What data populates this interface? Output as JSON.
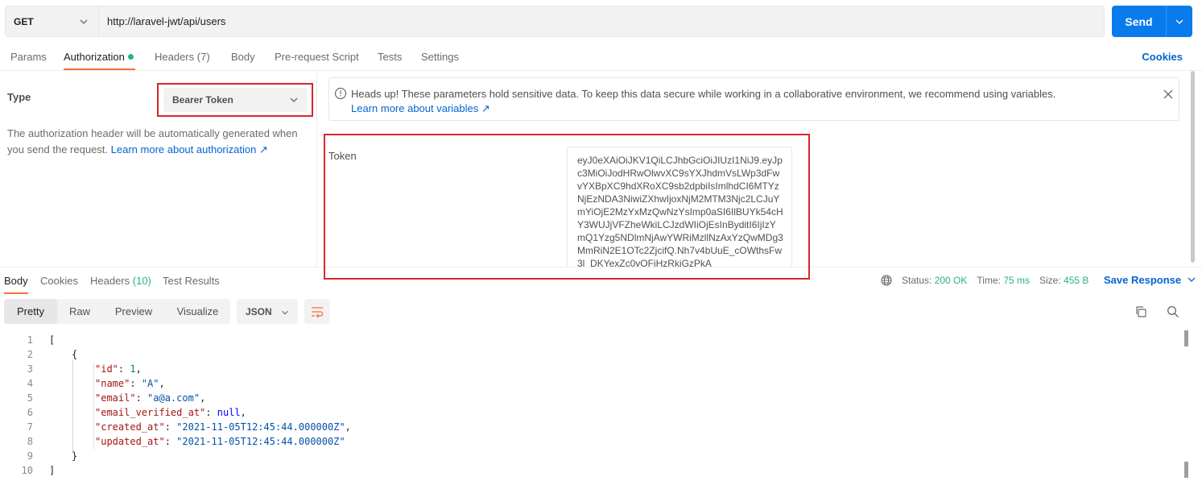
{
  "request": {
    "method": "GET",
    "url": "http://laravel-jwt/api/users",
    "send_label": "Send"
  },
  "request_tabs": {
    "params": "Params",
    "authorization": "Authorization",
    "headers": "Headers",
    "headers_count": "(7)",
    "body": "Body",
    "pre_request": "Pre-request Script",
    "tests": "Tests",
    "settings": "Settings",
    "cookies": "Cookies"
  },
  "auth": {
    "type_label": "Type",
    "type_value": "Bearer Token",
    "description": "The authorization header will be automatically generated when you send the request. ",
    "learn_more": "Learn more about authorization ↗",
    "notice_text": "Heads up! These parameters hold sensitive data. To keep this data secure while working in a collaborative environment, we recommend using variables.",
    "notice_link": "Learn more about variables ↗",
    "token_label": "Token",
    "token_value": "eyJ0eXAiOiJKV1QiLCJhbGciOiJIUzI1NiJ9.eyJpc3MiOiJodHRwOlwvXC9sYXJhdmVsLWp3dFwvYXBpXC9hdXRoXC9sb2dpbiIsImlhdCI6MTYzNjEzNDA3NiwiZXhwIjoxNjM2MTM3Njc2LCJuYmYiOjE2MzYxMzQwNzYsImp0aSI6IlBUYk54cHY3WUJjVFZheWkiLCJzdWIiOjEsInByditI6IjIzYmQ1Yzg5NDlmNjAwYWRiMzllNzAxYzQwMDg3MmRiN2E1OTc2ZjcifQ.Nh7v4bUuE_cOWthsFw3l_DKYexZc0yOFjHzRkjGzPkA"
  },
  "response_tabs": {
    "body": "Body",
    "cookies": "Cookies",
    "headers": "Headers",
    "headers_count": "(10)",
    "test_results": "Test Results"
  },
  "response_status": {
    "status_label": "Status:",
    "status_value": "200 OK",
    "time_label": "Time:",
    "time_value": "75 ms",
    "size_label": "Size:",
    "size_value": "455 B",
    "save_response": "Save Response"
  },
  "view_modes": {
    "pretty": "Pretty",
    "raw": "Raw",
    "preview": "Preview",
    "visualize": "Visualize",
    "format": "JSON"
  },
  "response_body": {
    "line_numbers": [
      "1",
      "2",
      "3",
      "4",
      "5",
      "6",
      "7",
      "8",
      "9",
      "10"
    ],
    "open_bracket": "[",
    "open_brace": "{",
    "close_brace": "}",
    "close_bracket": "]",
    "fields": [
      {
        "key": "\"id\"",
        "value": "1",
        "kind": "num"
      },
      {
        "key": "\"name\"",
        "value": "\"A\"",
        "kind": "str"
      },
      {
        "key": "\"email\"",
        "value": "\"a@a.com\"",
        "kind": "str"
      },
      {
        "key": "\"email_verified_at\"",
        "value": "null",
        "kind": "kw"
      },
      {
        "key": "\"created_at\"",
        "value": "\"2021-11-05T12:45:44.000000Z\"",
        "kind": "str"
      },
      {
        "key": "\"updated_at\"",
        "value": "\"2021-11-05T12:45:44.000000Z\"",
        "kind": "str"
      }
    ]
  }
}
